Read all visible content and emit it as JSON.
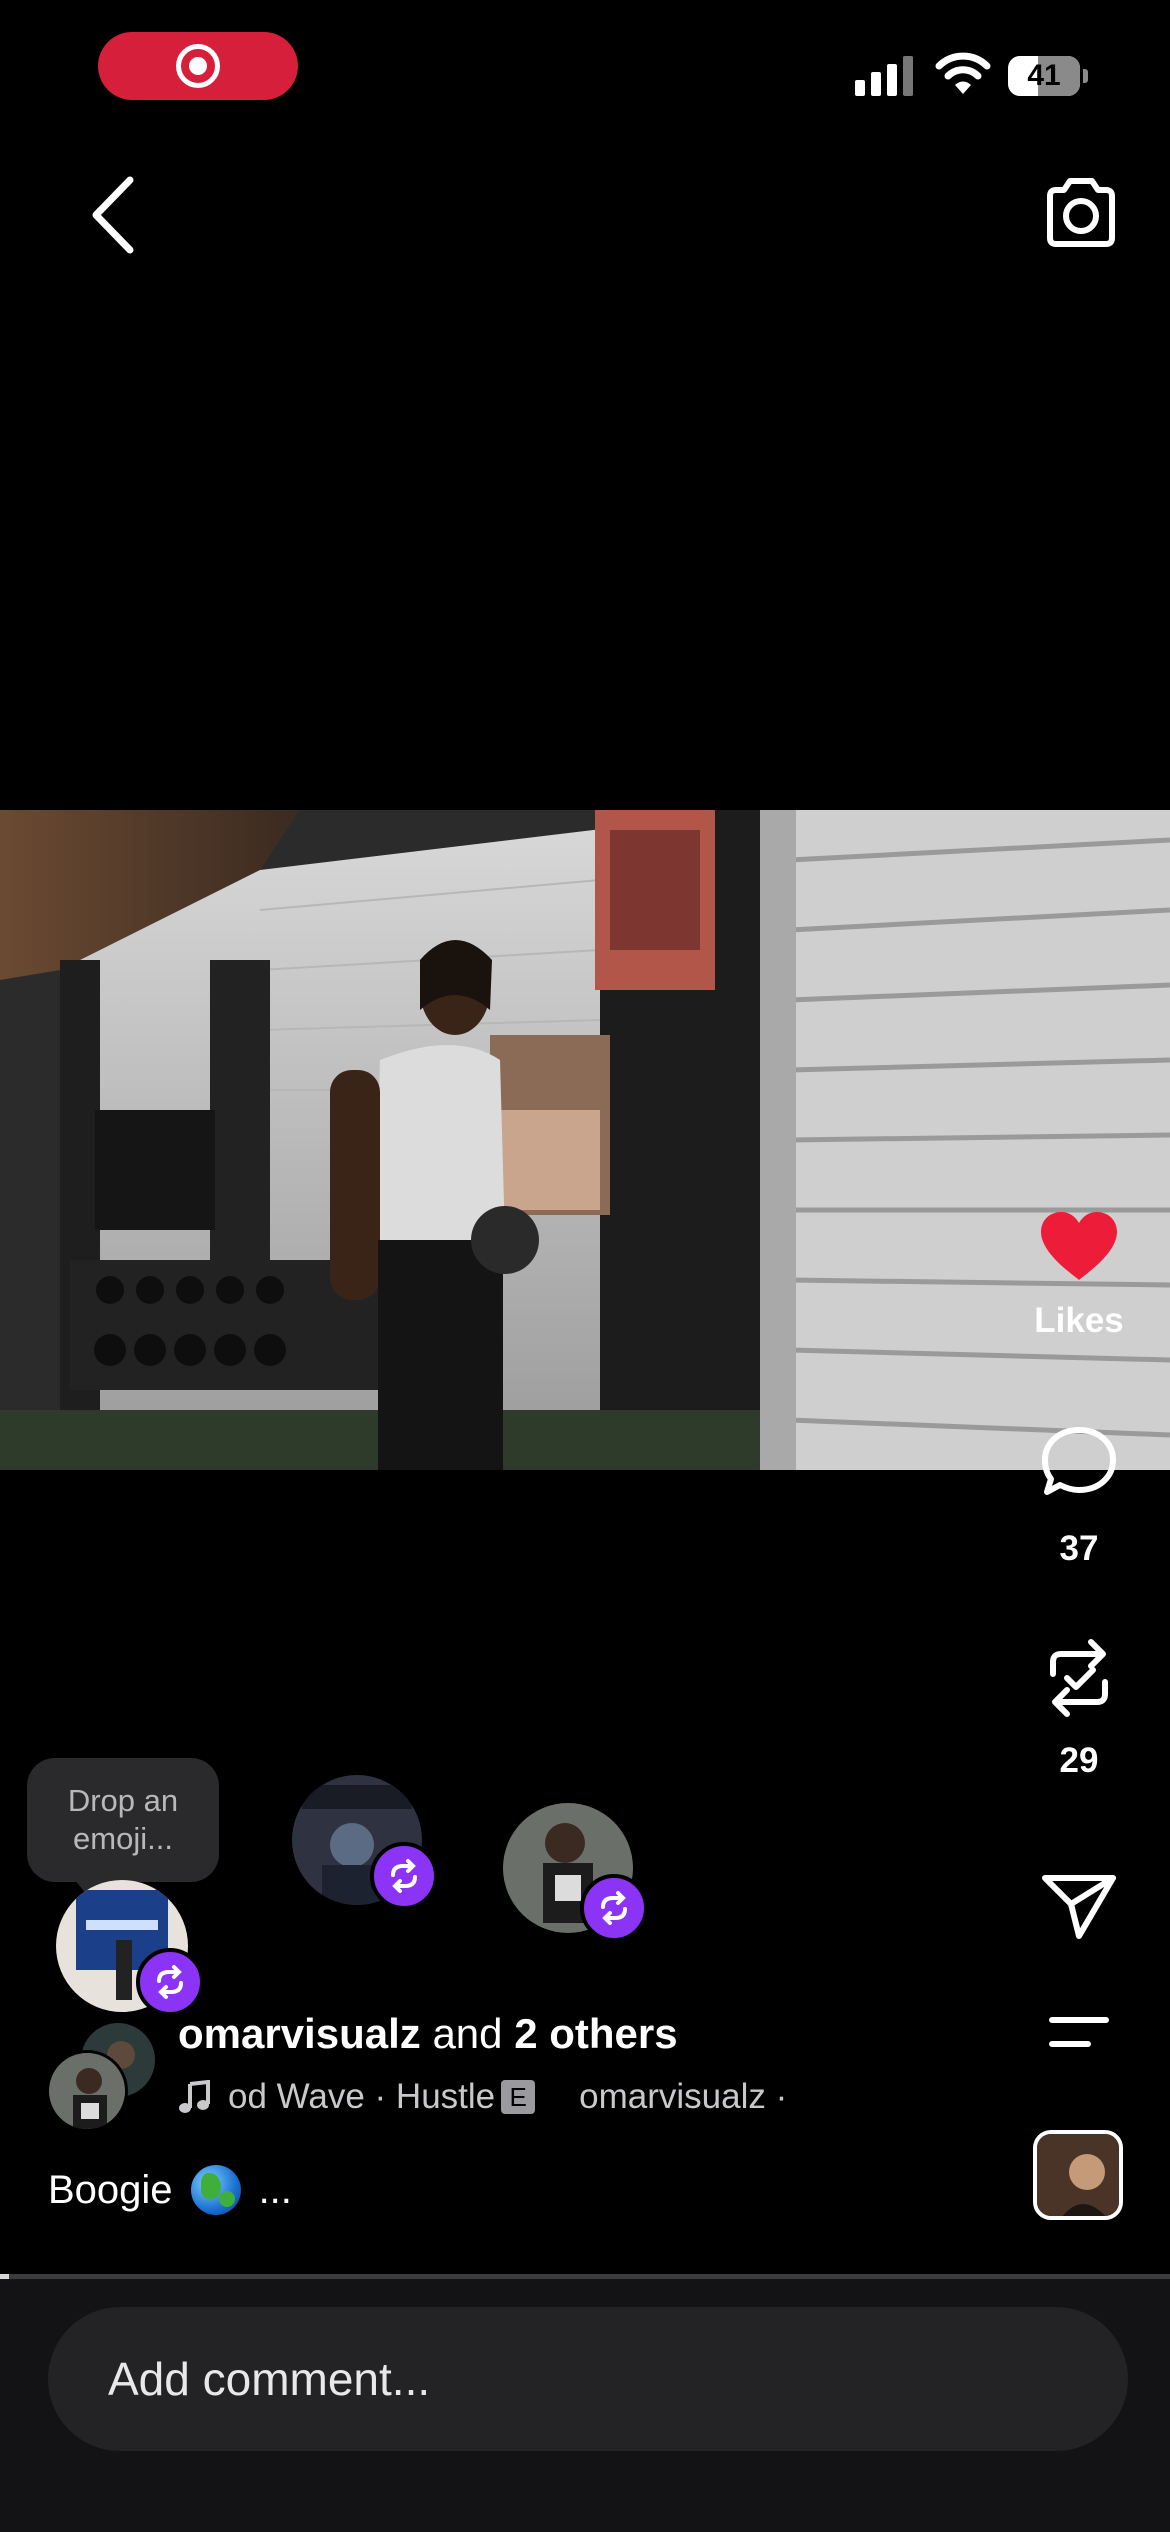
{
  "status_bar": {
    "battery_level": "41",
    "battery_fraction": 0.41,
    "recording_icon": "record-icon",
    "signal_icon": "cellular-signal-icon",
    "wifi_icon": "wifi-icon"
  },
  "nav": {
    "back_icon": "chevron-left-icon",
    "camera_icon": "camera-icon"
  },
  "actions": {
    "likes_label": "Likes",
    "comments_count": "37",
    "reposts_count": "29",
    "like_color": "#ed1d3a"
  },
  "emoji_prompt": "Drop an emoji...",
  "post": {
    "author": "omarvisualz",
    "author_suffix_connector": "and",
    "others": "2 others",
    "music": {
      "track": "od Wave · Hustle",
      "explicit": "E",
      "artist": "omarvisualz ·"
    },
    "caption_text": "Boogie",
    "caption_more": "..."
  },
  "playback_progress": 0.008,
  "comment": {
    "placeholder": "Add comment..."
  },
  "colors": {
    "repost_badge": "#8b34f5",
    "record_pill": "#d61f3a"
  }
}
